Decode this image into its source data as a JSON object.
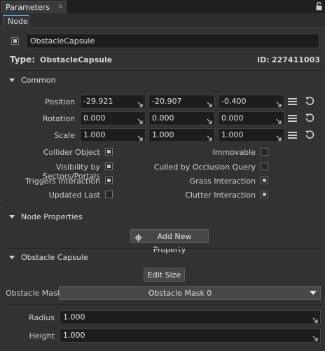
{
  "tabs": {
    "main": "Parameters",
    "close": "×",
    "sub": "Node"
  },
  "node": {
    "name": "ObstacleCapsule",
    "enabled": true
  },
  "type_row": {
    "type_label": "Type:",
    "type_value": "ObstacleCapsule",
    "id_label": "ID:",
    "id_value": "227411003"
  },
  "common": {
    "title": "Common",
    "position": {
      "label": "Position",
      "x": "-29.921",
      "y": "-20.907",
      "z": "-0.400"
    },
    "rotation": {
      "label": "Rotation",
      "x": "0.000",
      "y": "0.000",
      "z": "0.000"
    },
    "scale": {
      "label": "Scale",
      "x": "1.000",
      "y": "1.000",
      "z": "1.000"
    },
    "flags": {
      "collider_object": {
        "label": "Collider Object",
        "checked": true
      },
      "immovable": {
        "label": "Immovable",
        "checked": false
      },
      "visibility_by_sectors": {
        "label": "Visibility by Sectors/Portals",
        "checked": true
      },
      "culled_by_occlusion": {
        "label": "Culled by Occlusion Query",
        "checked": false
      },
      "triggers_interaction": {
        "label": "Triggers Interaction",
        "checked": true
      },
      "grass_interaction": {
        "label": "Grass Interaction",
        "checked": true
      },
      "updated_last": {
        "label": "Updated Last",
        "checked": false
      },
      "clutter_interaction": {
        "label": "Clutter Interaction",
        "checked": true
      }
    }
  },
  "node_properties": {
    "title": "Node Properties",
    "add_button": "Add New Property"
  },
  "obstacle_capsule": {
    "title": "Obstacle Capsule",
    "edit_button": "Edit Size",
    "mask_label": "Obstacle Mask",
    "mask_value": "Obstacle Mask 0",
    "radius_label": "Radius",
    "radius_value": "1.000",
    "height_label": "Height",
    "height_value": "1.000"
  },
  "colors": {
    "background": "#323232",
    "input_bg": "#1d1d1d",
    "accent": "#4aa3df"
  }
}
